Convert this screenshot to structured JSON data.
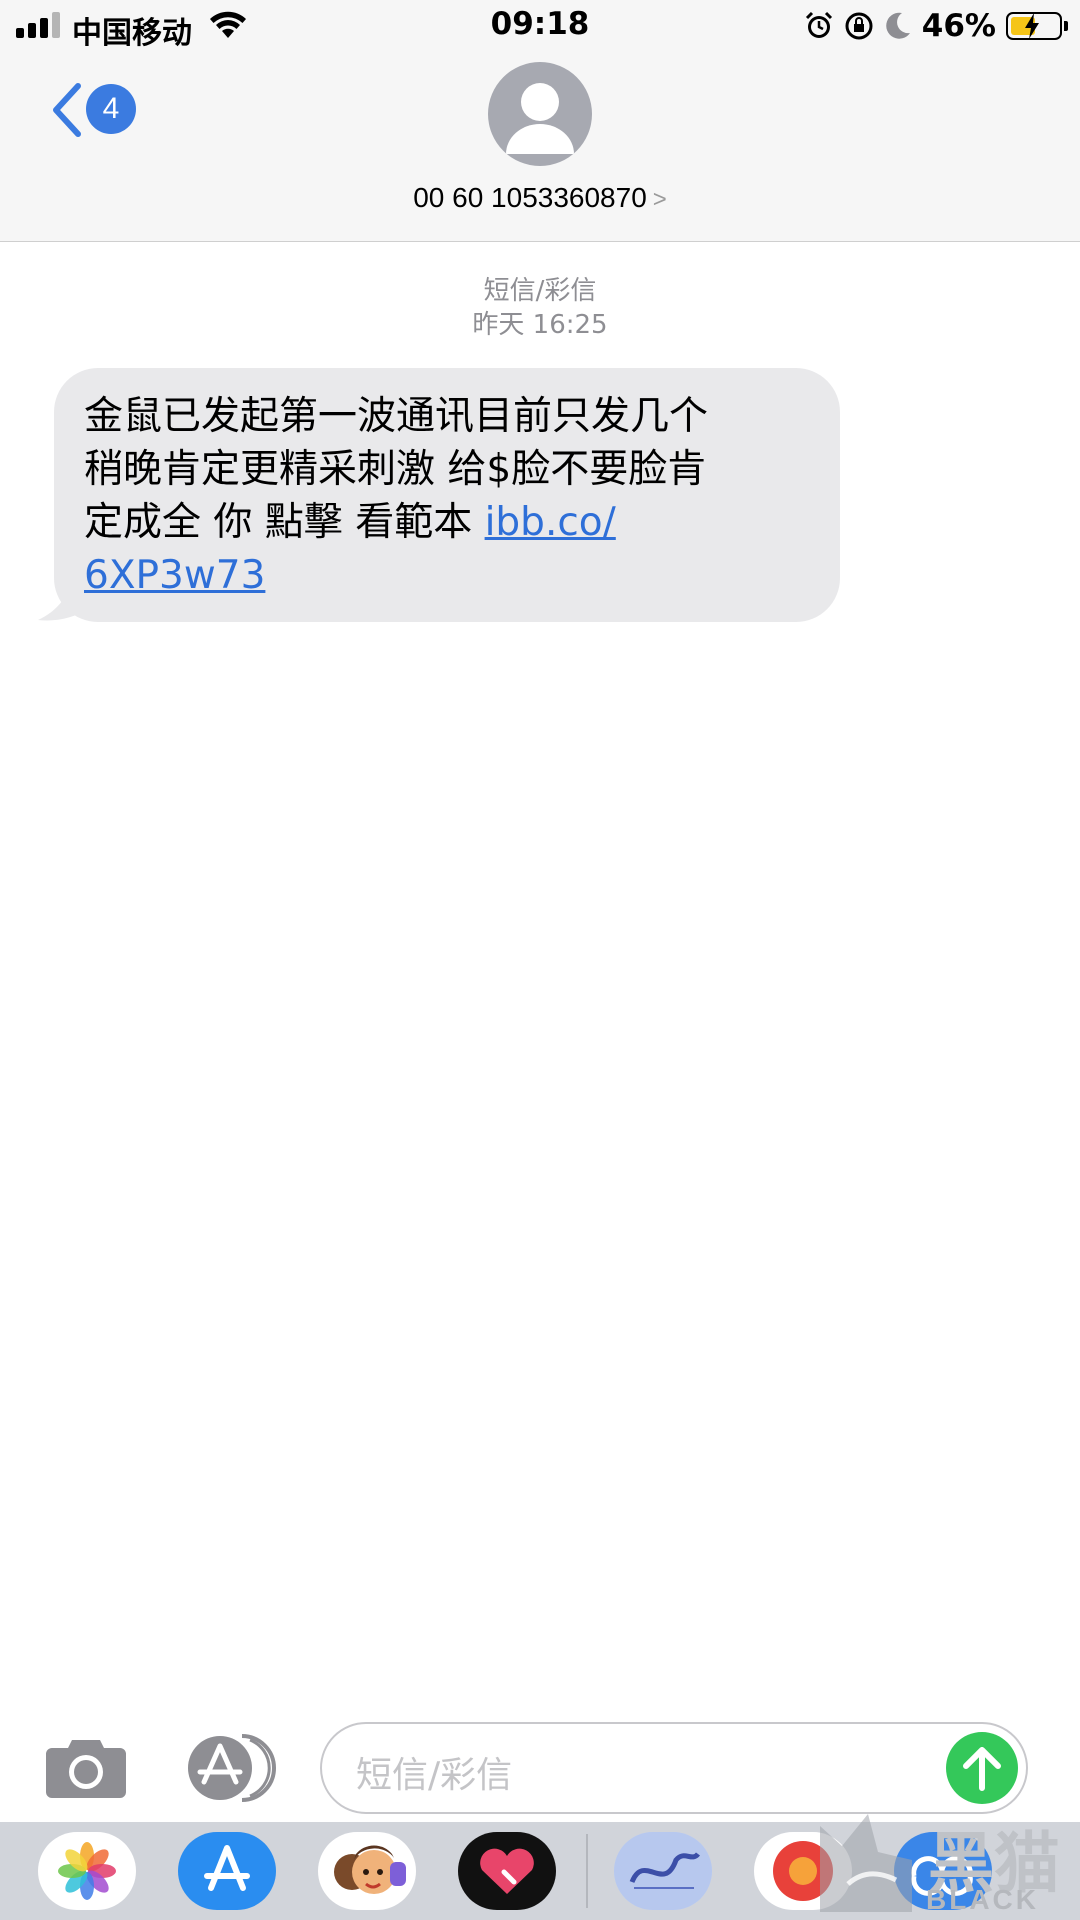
{
  "status_bar": {
    "carrier": "中国移动",
    "time": "09:18",
    "battery_percent": "46%",
    "icons": [
      "signal-icon",
      "wifi-icon",
      "alarm-icon",
      "rotation-lock-icon",
      "moon-icon",
      "battery-charging-icon"
    ]
  },
  "nav": {
    "back_icon": "chevron-left-icon",
    "unread_count": "4",
    "avatar_icon": "person-icon",
    "contact": "00 60 1053360870",
    "contact_chevron": ">"
  },
  "thread": {
    "service_label": "短信/彩信",
    "timestamp": "昨天 16:25",
    "message": {
      "line1": "金鼠已发起第一波通讯目前只发几个",
      "line2": "稍晚肯定更精采刺激 给$脸不要脸肯",
      "line3_text": "定成全 你 點擊 看範本 ",
      "link_part1": "ibb.co/",
      "link_part2": "6XP3w73"
    }
  },
  "composer": {
    "placeholder": "短信/彩信",
    "camera_icon": "camera-icon",
    "appstore_icon": "app-store-icon",
    "send_icon": "arrow-up-icon"
  },
  "app_drawer": {
    "apps": [
      "photos-icon",
      "app-store-icon",
      "memoji-icon",
      "digital-touch-icon",
      "game-app-icon",
      "music-app-icon",
      "app-icon"
    ]
  },
  "watermark": {
    "cn": "黑猫",
    "en": "BLACK CAT"
  },
  "colors": {
    "ios_blue": "#3b7be0",
    "bubble_gray": "#e9e9eb",
    "send_green": "#34c85a",
    "link_blue": "#2e6fd8"
  }
}
